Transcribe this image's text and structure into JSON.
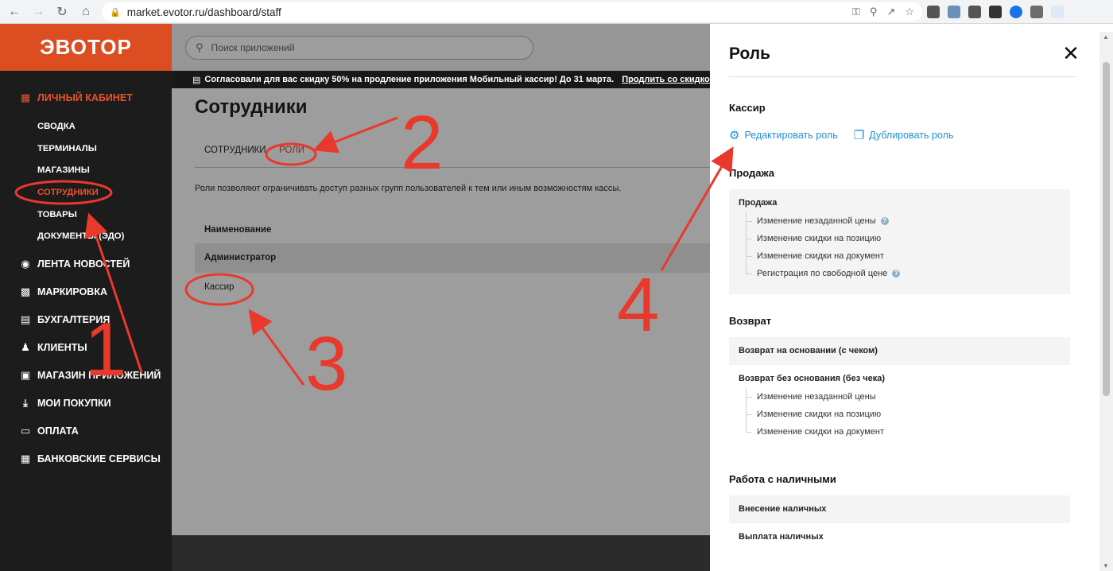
{
  "browser": {
    "url": "market.evotor.ru/dashboard/staff"
  },
  "sidebar": {
    "logo": "ЭВОТОР",
    "cabinet": "ЛИЧНЫЙ КАБИНЕТ",
    "sub_items": [
      "СВОДКА",
      "ТЕРМИНАЛЫ",
      "МАГАЗИНЫ",
      "СОТРУДНИКИ",
      "ТОВАРЫ",
      "ДОКУМЕНТЫ (ЭДО)"
    ],
    "items": [
      "ЛЕНТА НОВОСТЕЙ",
      "МАРКИРОВКА",
      "БУХГАЛТЕРИЯ",
      "КЛИЕНТЫ",
      "МАГАЗИН ПРИЛОЖЕНИЙ",
      "МОИ ПОКУПКИ",
      "ОПЛАТА",
      "БАНКОВСКИЕ СЕРВИСЫ"
    ]
  },
  "header": {
    "search_placeholder": "Поиск приложений",
    "promo_text": "Согласовали для вас скидку 50% на продление приложения Мобильный кассир! До 31 марта.",
    "promo_link": "Продлить со скидкой >>>"
  },
  "main": {
    "title": "Сотрудники",
    "tabs": [
      "СОТРУДНИКИ",
      "РОЛИ"
    ],
    "hint": "Роли позволяют ограничивать доступ разных групп пользователей к тем или иным возможностям кассы.",
    "column_name": "Наименование",
    "rows": [
      "Администратор",
      "Кассир"
    ]
  },
  "panel": {
    "title": "Роль",
    "role_name": "Кассир",
    "edit_action": "Редактировать роль",
    "duplicate_action": "Дублировать роль",
    "sections": [
      {
        "title": "Продажа",
        "groups": [
          {
            "name": "Продажа",
            "leaves": [
              "Изменение незаданной цены",
              "Изменение скидки на позицию",
              "Изменение скидки на документ",
              "Регистрация по свободной цене"
            ]
          }
        ]
      },
      {
        "title": "Возврат",
        "groups": [
          {
            "name": "Возврат на основании (с чеком)",
            "leaves": []
          },
          {
            "name": "Возврат без основания (без чека)",
            "leaves": [
              "Изменение незаданной цены",
              "Изменение скидки на позицию",
              "Изменение скидки на документ"
            ]
          }
        ]
      },
      {
        "title": "Работа с наличными",
        "groups": [
          {
            "name": "Внесение наличных",
            "leaves": []
          },
          {
            "name": "Выплата наличных",
            "leaves": []
          }
        ]
      }
    ]
  },
  "annotations": [
    "1",
    "2",
    "3",
    "4"
  ],
  "colors": {
    "brand": "#dd4d22",
    "active": "#e8532a",
    "link": "#1f8fd6",
    "annotation": "#e8392c"
  }
}
